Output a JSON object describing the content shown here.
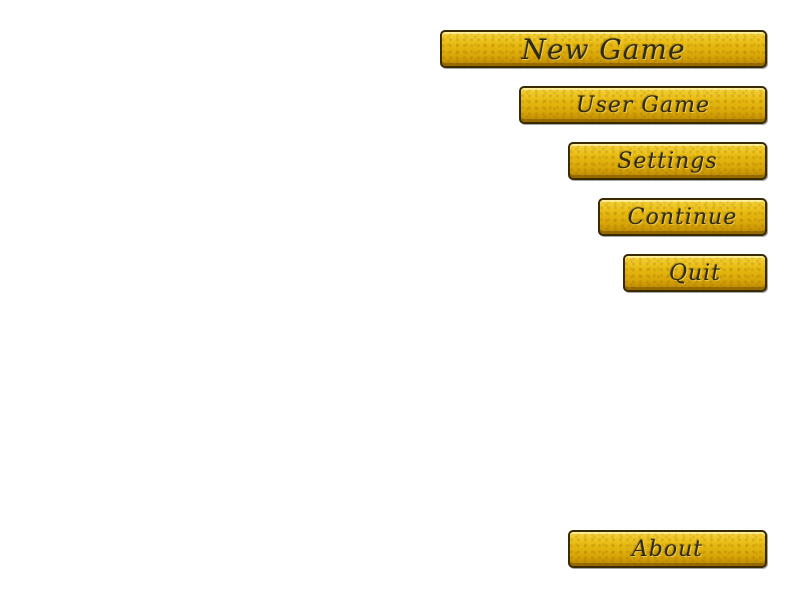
{
  "menu": {
    "new_game": "New Game",
    "user_game": "User Game",
    "settings": "Settings",
    "continue": "Continue",
    "quit": "Quit"
  },
  "footer": {
    "about": "About"
  },
  "colors": {
    "button_gold": "#e8bb12",
    "button_border": "#3a2a00",
    "label_text": "#2f2a18",
    "background": "#ffffff"
  }
}
